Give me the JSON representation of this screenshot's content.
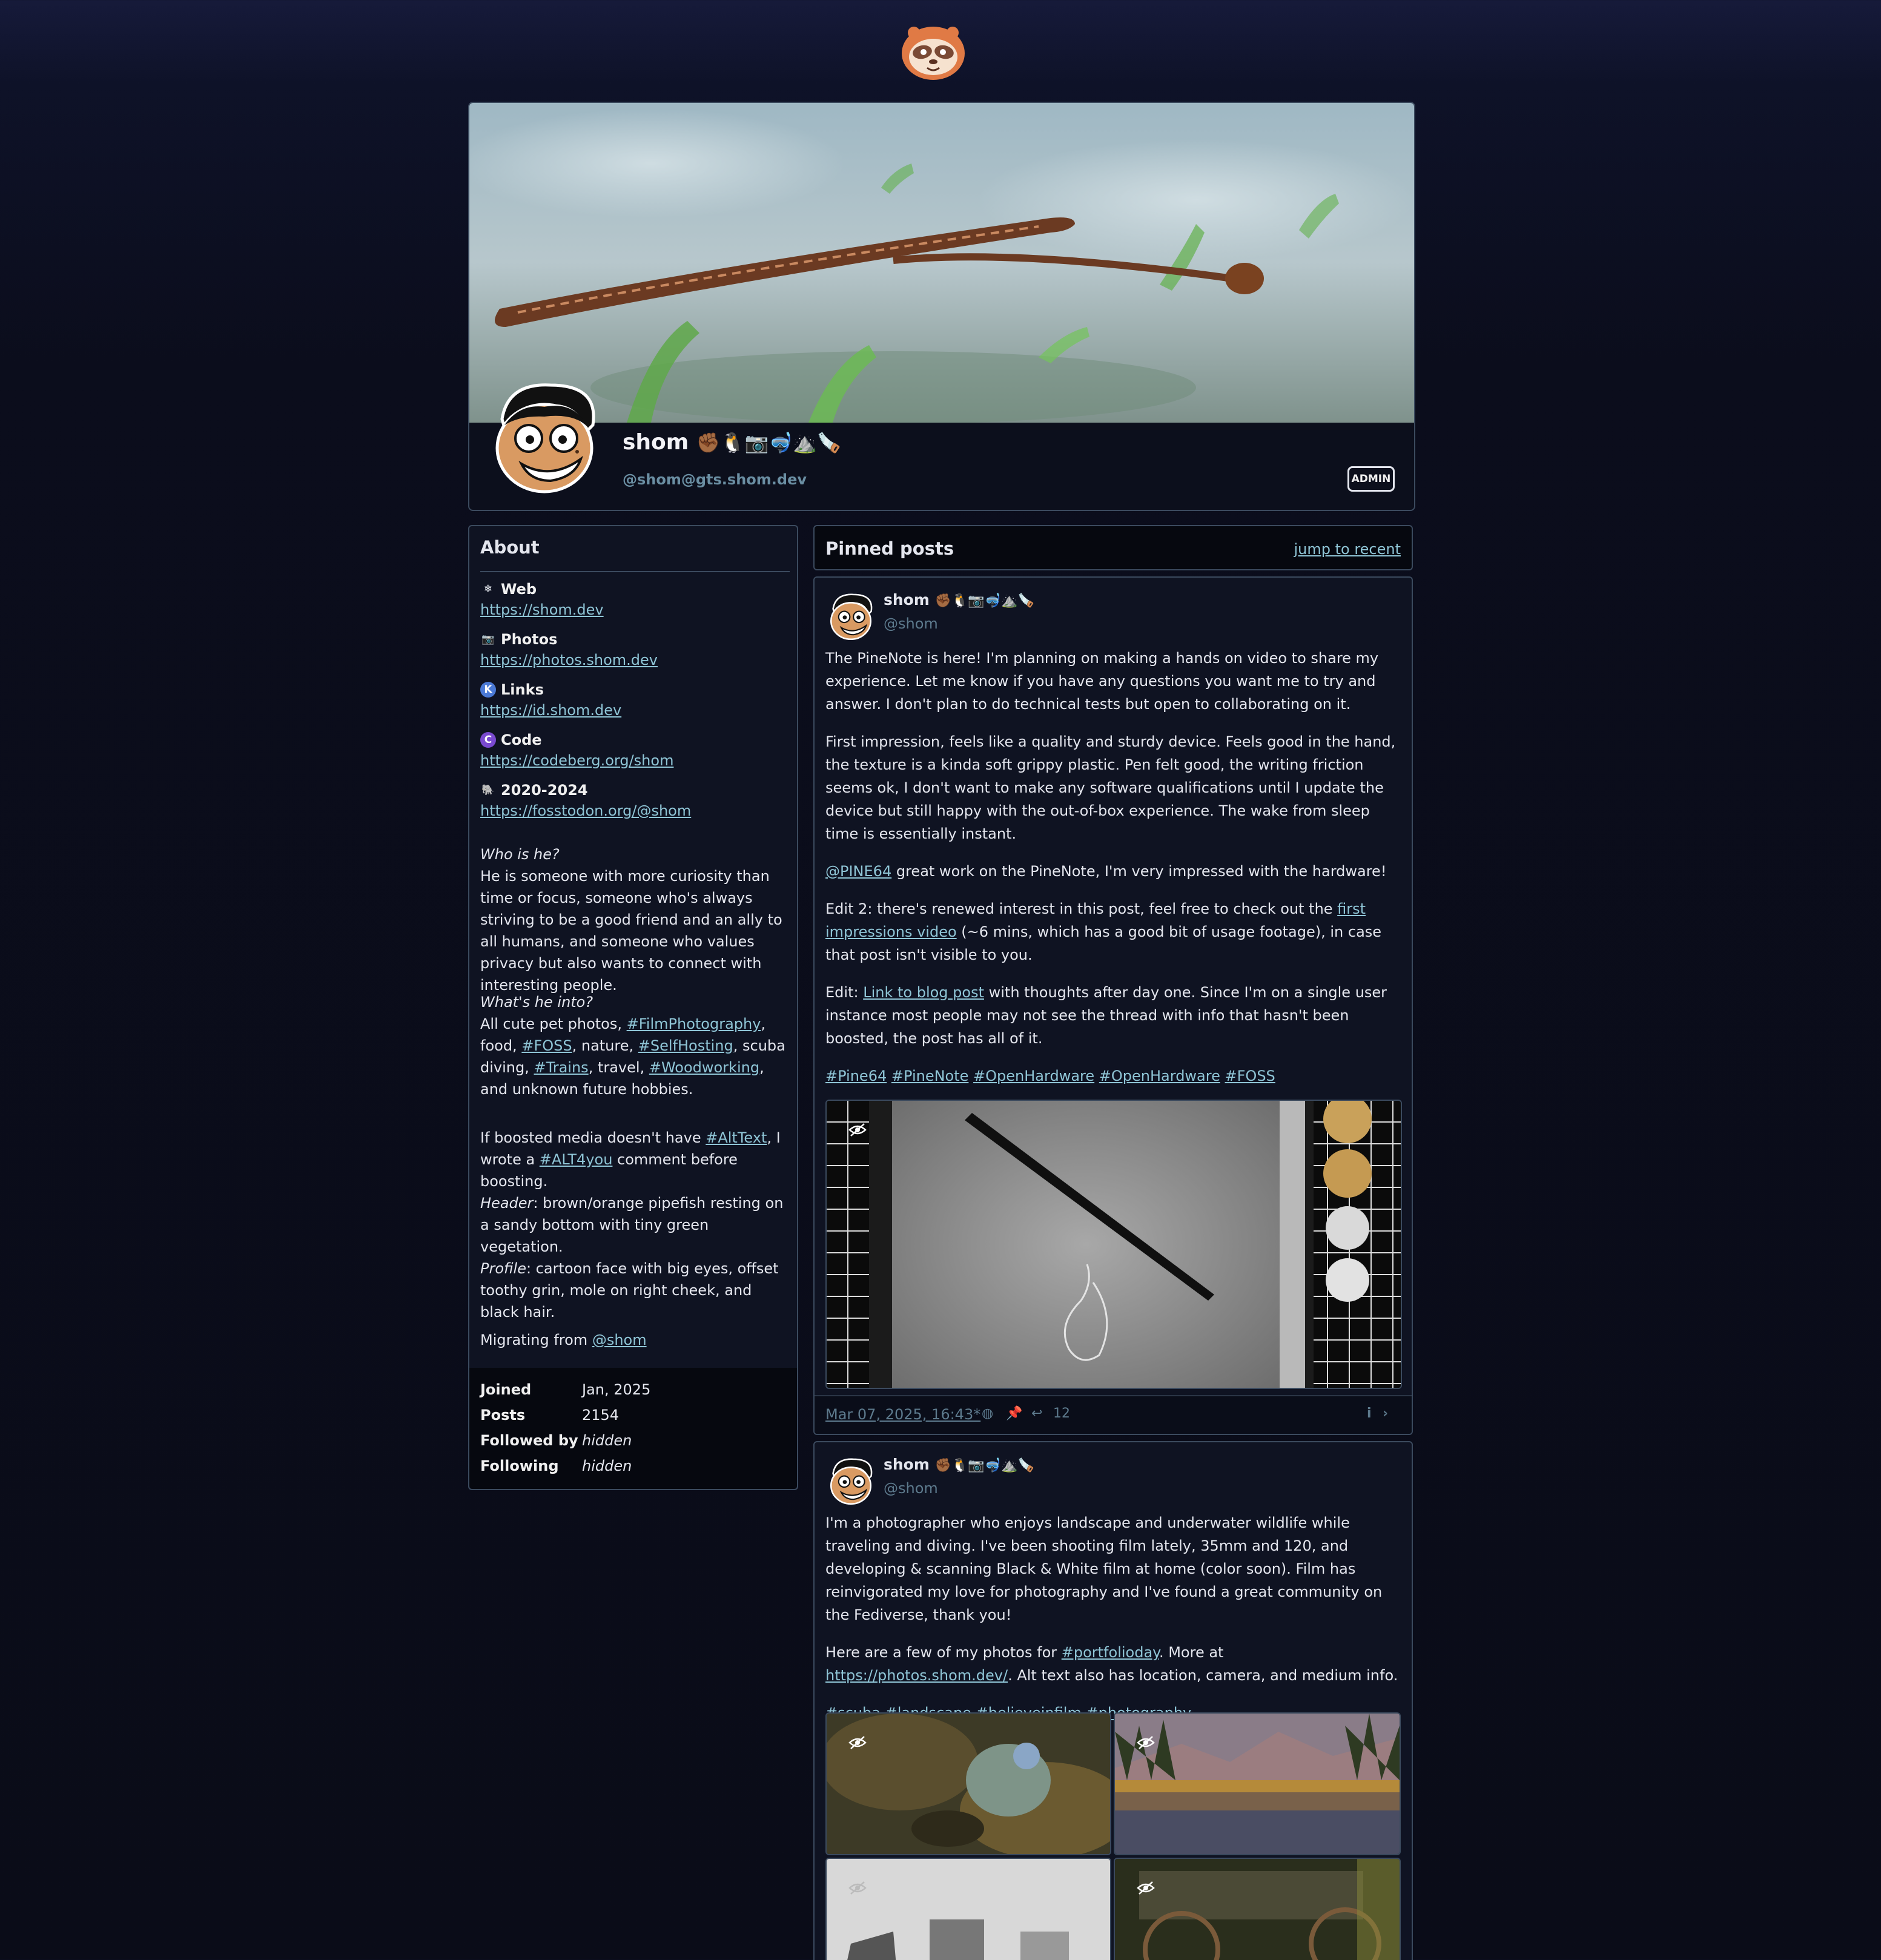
{
  "profile": {
    "display_name": "shom",
    "name_emojis": "✊🏾🐧📷🤿⛰️🪚",
    "handle": "@shom@gts.shom.dev",
    "role": "ADMIN"
  },
  "about": {
    "title": "About",
    "fields": [
      {
        "icon": "snowflake-icon",
        "glyph": "❄",
        "name": "Web",
        "value": "https://shom.dev"
      },
      {
        "icon": "camera-icon",
        "glyph": "📷",
        "name": "Photos",
        "value": "https://photos.shom.dev"
      },
      {
        "icon": "keyoxide-icon",
        "glyph": "K",
        "name": "Links",
        "value": "https://id.shom.dev"
      },
      {
        "icon": "codeberg-icon",
        "glyph": "C",
        "name": "Code",
        "value": "https://codeberg.org/shom"
      },
      {
        "icon": "mastodon-icon",
        "glyph": "🐘",
        "name": "2020-2024",
        "value": "https://fosstodon.org/@shom"
      }
    ],
    "bio_q1": "Who is he?",
    "bio_a1": "He is someone with more curiosity than time or focus, someone who's always striving to be a good friend and an ally to all humans, and someone who values privacy but also wants to connect with interesting people.",
    "bio_q2": "What's he into?",
    "bio_a2_pre": "All cute pet photos, ",
    "tag_filmphotography": "#FilmPhotography",
    "bio_a2_food": ", food, ",
    "tag_foss": "#FOSS",
    "bio_a2_nature": ", nature, ",
    "tag_selfhosting": "#SelfHosting",
    "bio_a2_scuba": ", scuba diving, ",
    "tag_trains": "#Trains",
    "bio_a2_travel": ", travel, ",
    "tag_woodworking": "#Woodworking",
    "bio_a2_end": ", and unknown future hobbies.",
    "bio_alt_pre": "If boosted media doesn't have ",
    "tag_alttext": "#AltText",
    "bio_alt_mid": ", I wrote a ",
    "tag_alt4you": "#ALT4you",
    "bio_alt_end": " comment before boosting.",
    "header_label": "Header",
    "header_desc": ": brown/orange pipefish resting on a sandy bottom with tiny green vegetation.",
    "profile_label": "Profile",
    "profile_desc": ": cartoon face with big eyes, offset toothy grin, mole on right cheek, and black hair.",
    "migrating_pre": "Migrating from ",
    "migrating_link": "@shom",
    "stats": [
      {
        "label": "Joined",
        "value": "Jan, 2025"
      },
      {
        "label": "Posts",
        "value": "2154"
      },
      {
        "label": "Followed by",
        "value": "hidden"
      },
      {
        "label": "Following",
        "value": "hidden"
      }
    ]
  },
  "pinned": {
    "title": "Pinned posts",
    "jump_label": "jump to recent"
  },
  "status1": {
    "name": "shom",
    "name_emojis": "✊🏾🐧📷🤿⛰️🪚",
    "handle": "@shom",
    "p1": "The PineNote is here! I'm planning on making a hands on video to share my experience. Let me know if you have any questions you want me to try and answer. I don't plan to do technical tests but open to collaborating on it.",
    "p2": "First impression, feels like a quality and sturdy device. Feels good in the hand, the texture is a kinda soft grippy plastic. Pen felt good, the writing friction seems ok, I don't want to make any software qualifications until I update the device but still happy with the out-of-box experience. The wake from sleep time is essentially instant.",
    "p3_mention": "@PINE64",
    "p3_rest": " great work on the PineNote, I'm very impressed with the hardware!",
    "p4_pre": "Edit 2: there's renewed interest in this post, feel free to check out the ",
    "p4_link": "first impressions video",
    "p4_post": " (~6 mins, which has a good bit of usage footage), in case that post isn't visible to you.",
    "p5_pre": "Edit: ",
    "p5_link": "Link to blog post",
    "p5_post": " with thoughts after day one. Since I'm on a single user instance most people may not see the thread with info that hasn't been boosted, the post has all of it.",
    "tags": [
      "#Pine64",
      "#PineNote",
      "#OpenHardware",
      "#OpenHardware",
      "#FOSS"
    ],
    "date": "Mar 07, 2025, 16:43*",
    "replies": "12"
  },
  "status2": {
    "name": "shom",
    "name_emojis": "✊🏾🐧📷🤿⛰️🪚",
    "handle": "@shom",
    "p1": "I'm a photographer who enjoys landscape and underwater wildlife while traveling and diving. I've been shooting film lately, 35mm and 120, and developing & scanning Black & White film at home (color soon). Film has reinvigorated my love for photography and I've found a great community on the Fediverse, thank you!",
    "p2_pre": "Here are a few of my photos for ",
    "p2_tag": "#portfolioday",
    "p2_mid": ". More at ",
    "p2_link": "https://photos.shom.dev/",
    "p2_post": ". Alt text also has location, camera, and medium info.",
    "tags": [
      "#scuba",
      "#landscape",
      "#believeinfilm",
      "#photography"
    ]
  }
}
